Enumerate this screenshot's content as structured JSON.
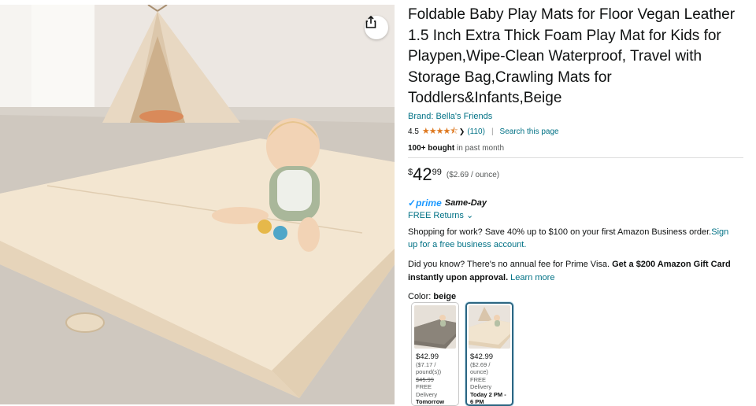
{
  "product": {
    "title": "Foldable Baby Play Mats for Floor Vegan Leather 1.5 Inch Extra Thick Foam Play Mat for Kids for Playpen,Wipe-Clean Waterproof, Travel with Storage Bag,Crawling Mats for Toddlers&Infants,Beige",
    "brand": "Brand: Bella's Friends",
    "rating_value": "4.5",
    "stars": "★★★★⯪",
    "rating_chevron": "❯",
    "rating_count": "(110)",
    "separator": "|",
    "search_page": "Search this page",
    "bought_bold": "100+ bought",
    "bought_rest": " in past month"
  },
  "price": {
    "symbol": "$",
    "whole": "42",
    "fraction": "99",
    "unit_price": "($2.69 / ounce)"
  },
  "delivery": {
    "prime_check": "✓",
    "prime_word": "prime",
    "same_day": "Same-Day",
    "returns": "FREE Returns ⌄"
  },
  "business": {
    "text": "Shopping for work? Save 40% up to $100 on your first Amazon Business order.",
    "link": "Sign up for a free business account."
  },
  "prime_visa": {
    "text": "Did you know? There's no annual fee for Prime Visa. ",
    "bold": "Get a $200 Amazon Gift Card instantly upon approval.",
    "link": " Learn more"
  },
  "color": {
    "label": "Color: ",
    "selected": "beige",
    "options": [
      {
        "name": "gray",
        "price": "$42.99",
        "per_unit": "($7.17 / pound(s))",
        "list_price": "$45.99",
        "delivery": "FREE Delivery",
        "delivery_when": "Tomorrow"
      },
      {
        "name": "beige",
        "price": "$42.99",
        "per_unit": "($2.69 / ounce)",
        "list_price": "",
        "delivery": "FREE Delivery",
        "delivery_when": "Today 2 PM - 6 PM"
      }
    ]
  },
  "icons": {
    "share": "share-icon"
  },
  "colors": {
    "link": "#007185",
    "prime": "#1a98ff",
    "star": "#de7921",
    "mat": "#efe0c8",
    "selected_border": "#2c6682"
  }
}
